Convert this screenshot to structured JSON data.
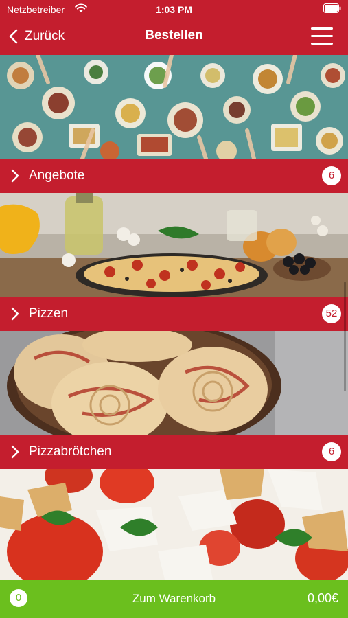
{
  "status_bar": {
    "carrier": "Netzbetreiber",
    "time": "1:03 PM"
  },
  "nav": {
    "back_label": "Zurück",
    "title": "Bestellen"
  },
  "categories": [
    {
      "label": "Angebote",
      "count": "6"
    },
    {
      "label": "Pizzen",
      "count": "52"
    },
    {
      "label": "Pizzabrötchen",
      "count": "6"
    }
  ],
  "cart": {
    "count": "0",
    "label": "Zum Warenkorb",
    "total": "0,00€"
  },
  "colors": {
    "brand_red": "#c41e2e",
    "cart_green": "#6bbf1e"
  },
  "icons": [
    "wifi-icon",
    "battery-icon",
    "chevron-left-icon",
    "hamburger-menu-icon",
    "chevron-right-icon"
  ]
}
